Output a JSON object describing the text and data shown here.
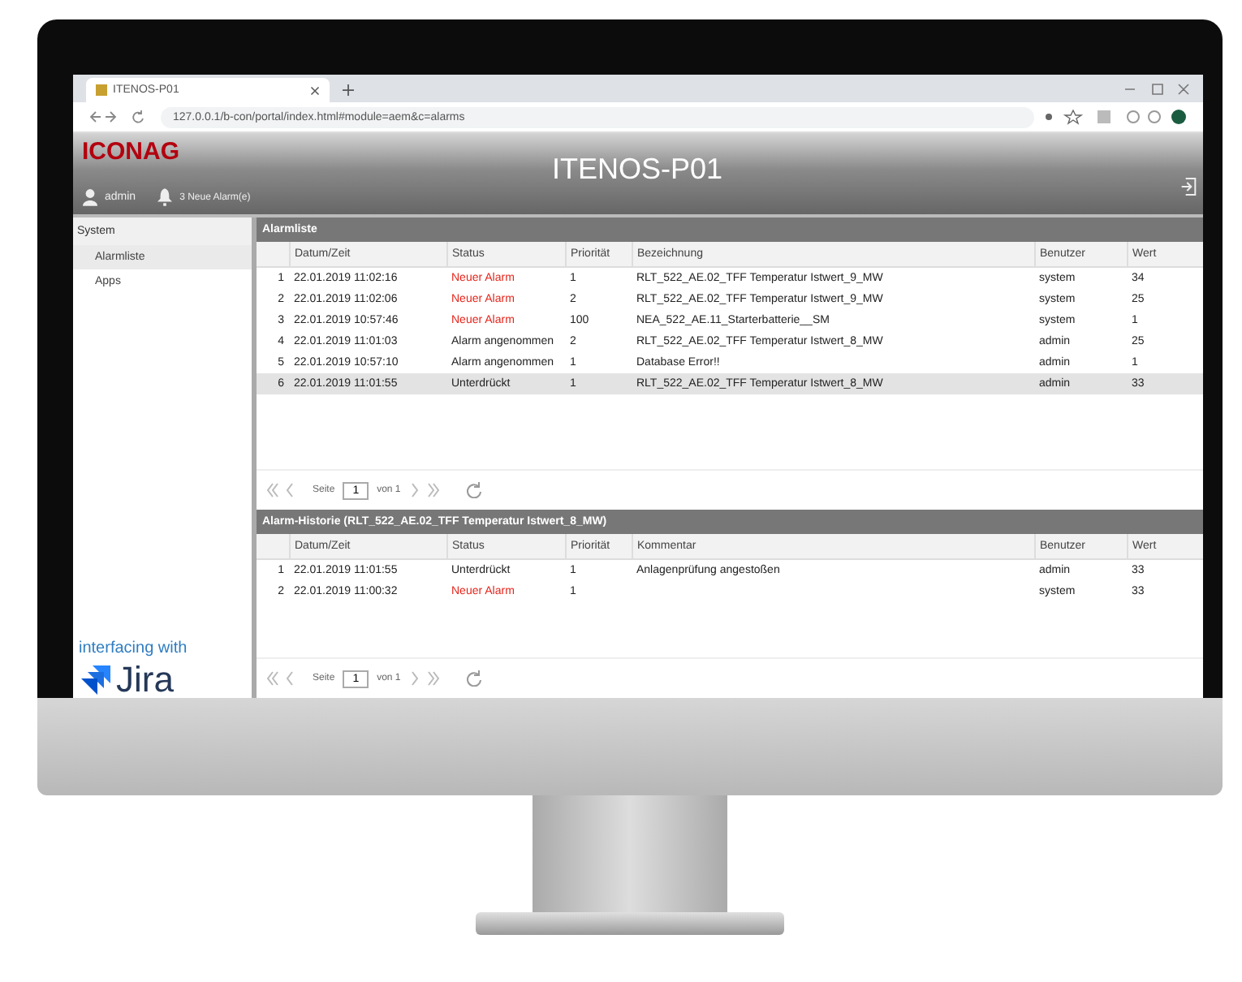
{
  "browser": {
    "tab_title": "ITENOS-P01",
    "url": "127.0.0.1/b-con/portal/index.html#module=aem&c=alarms"
  },
  "header": {
    "logo": "ICONAG",
    "user": "admin",
    "alarms": "3 Neue Alarm(e)",
    "title": "ITENOS-P01"
  },
  "sidebar": {
    "title": "System",
    "items": [
      {
        "label": "Alarmliste",
        "selected": true
      },
      {
        "label": "Apps",
        "selected": false
      }
    ],
    "promo": "interfacing with",
    "brand": "Jira"
  },
  "alarm_list": {
    "title": "Alarmliste",
    "columns": [
      "Datum/Zeit",
      "Status",
      "Priorität",
      "Bezeichnung",
      "Benutzer",
      "Wert"
    ],
    "rows": [
      {
        "index": "1",
        "time": "22.01.2019 11:02:16",
        "status": "Neuer Alarm",
        "alert": true,
        "priority": "1",
        "name": "RLT_522_AE.02_TFF Temperatur Istwert_9_MW",
        "user": "system",
        "value": "34",
        "selected": false
      },
      {
        "index": "2",
        "time": "22.01.2019 11:02:06",
        "status": "Neuer Alarm",
        "alert": true,
        "priority": "2",
        "name": "RLT_522_AE.02_TFF Temperatur Istwert_9_MW",
        "user": "system",
        "value": "25",
        "selected": false
      },
      {
        "index": "3",
        "time": "22.01.2019 10:57:46",
        "status": "Neuer Alarm",
        "alert": true,
        "priority": "100",
        "name": "NEA_522_AE.11_Starterbatterie__SM",
        "user": "system",
        "value": "1",
        "selected": false
      },
      {
        "index": "4",
        "time": "22.01.2019 11:01:03",
        "status": "Alarm angenommen",
        "alert": false,
        "priority": "2",
        "name": "RLT_522_AE.02_TFF Temperatur Istwert_8_MW",
        "user": "admin",
        "value": "25",
        "selected": false
      },
      {
        "index": "5",
        "time": "22.01.2019 10:57:10",
        "status": "Alarm angenommen",
        "alert": false,
        "priority": "1",
        "name": "Database Error!!",
        "user": "admin",
        "value": "1",
        "selected": false
      },
      {
        "index": "6",
        "time": "22.01.2019 11:01:55",
        "status": "Unterdrückt",
        "alert": false,
        "priority": "1",
        "name": "RLT_522_AE.02_TFF Temperatur Istwert_8_MW",
        "user": "admin",
        "value": "33",
        "selected": true
      }
    ],
    "pager": {
      "label": "Seite",
      "page": "1",
      "of": "von 1"
    }
  },
  "history": {
    "title": "Alarm-Historie (RLT_522_AE.02_TFF Temperatur Istwert_8_MW)",
    "columns": [
      "Datum/Zeit",
      "Status",
      "Priorität",
      "Kommentar",
      "Benutzer",
      "Wert"
    ],
    "rows": [
      {
        "index": "1",
        "time": "22.01.2019 11:01:55",
        "status": "Unterdrückt",
        "alert": false,
        "priority": "1",
        "name": "Anlagenprüfung angestoßen",
        "user": "admin",
        "value": "33",
        "selected": false
      },
      {
        "index": "2",
        "time": "22.01.2019 11:00:32",
        "status": "Neuer Alarm",
        "alert": true,
        "priority": "1",
        "name": "",
        "user": "system",
        "value": "33",
        "selected": false
      }
    ],
    "pager": {
      "label": "Seite",
      "page": "1",
      "of": "von 1"
    }
  }
}
